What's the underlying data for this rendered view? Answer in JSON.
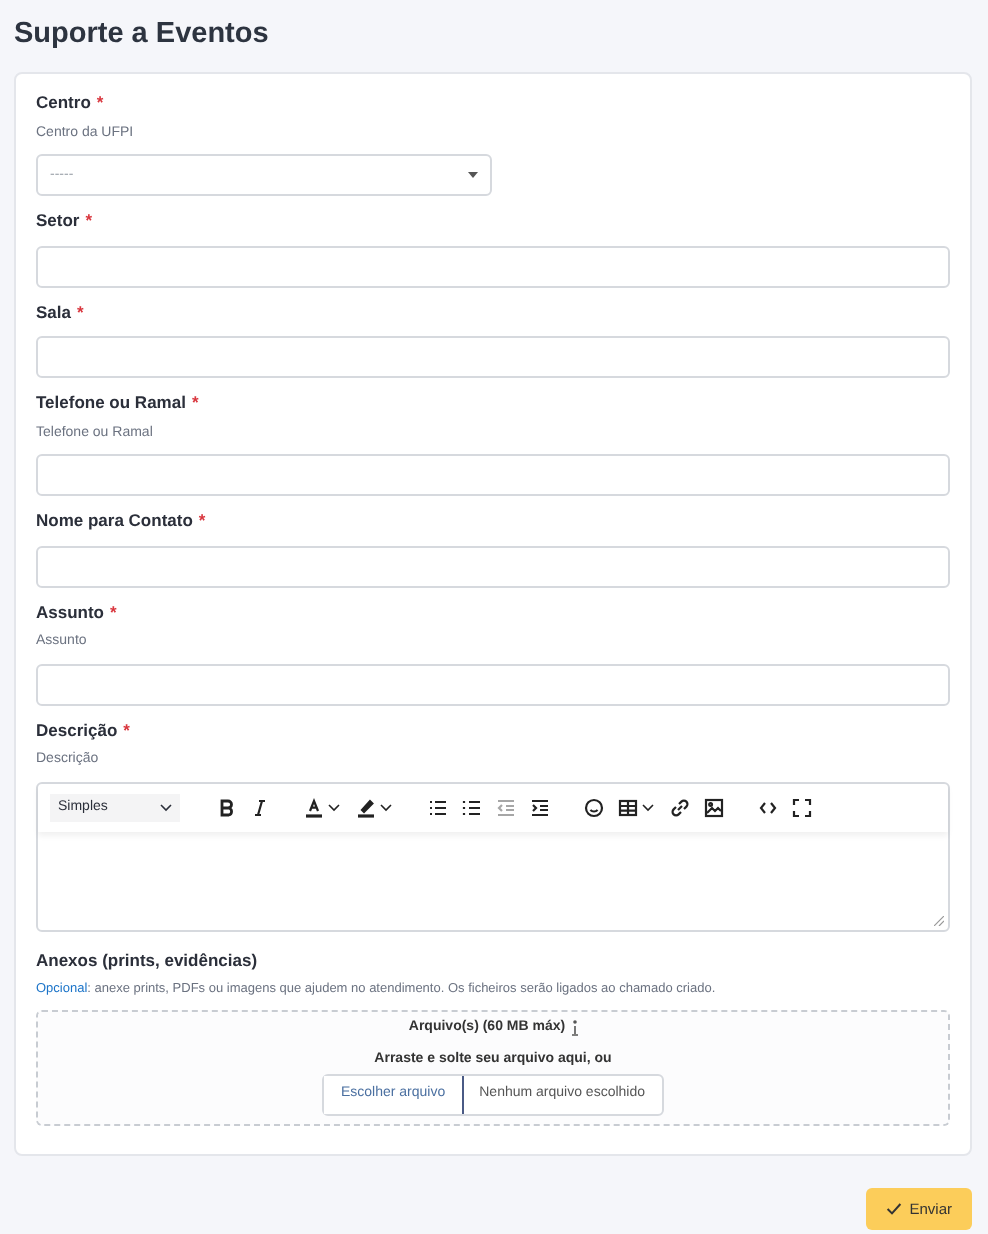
{
  "page_title": "Suporte a Eventos",
  "fields": [
    {
      "kind": "select",
      "label": "Centro",
      "required_mark": "*",
      "help": "Centro da UFPI",
      "value": "-----"
    },
    {
      "kind": "input",
      "label": "Setor",
      "required_mark": "*"
    },
    {
      "kind": "input",
      "label": "Sala",
      "required_mark": "*"
    },
    {
      "kind": "input",
      "label": "Telefone ou Ramal",
      "required_mark": "*",
      "help": "Telefone ou Ramal"
    },
    {
      "kind": "input",
      "label": "Nome para Contato",
      "required_mark": "*"
    },
    {
      "kind": "input",
      "label": "Assunto",
      "required_mark": "*",
      "help": "Assunto"
    },
    {
      "kind": "editor",
      "label": "Descrição",
      "required_mark": "*",
      "help": "Descrição",
      "style_select": "Simples",
      "toolbar": [
        {
          "kind": "bold",
          "disabled": false
        },
        {
          "kind": "italic",
          "disabled": false
        },
        {
          "kind": "text-color",
          "disabled": false
        },
        {
          "kind": "highlight",
          "disabled": false
        },
        {
          "kind": "bullet-list",
          "disabled": false
        },
        {
          "kind": "numbered-list",
          "disabled": false
        },
        {
          "kind": "outdent",
          "disabled": true
        },
        {
          "kind": "indent",
          "disabled": false
        },
        {
          "kind": "emoji",
          "disabled": false
        },
        {
          "kind": "table",
          "disabled": false
        },
        {
          "kind": "link",
          "disabled": false
        },
        {
          "kind": "image",
          "disabled": false
        },
        {
          "kind": "code",
          "disabled": false
        },
        {
          "kind": "fullscreen",
          "disabled": false
        }
      ]
    }
  ],
  "attachments": {
    "label": "Anexos (prints, evidências)",
    "help_link": "Opcional",
    "help": ": anexe prints, PDFs ou imagens que ajudem no atendimento. Os ficheiros serão ligados ao chamado criado.",
    "limit": "Arquivo(s) (60 MB máx)",
    "drop_text": "Arraste e solte seu arquivo aqui, ou",
    "choose_button": "Escolher arquivo",
    "file_status": "Nenhum arquivo escolhido"
  },
  "submit_button": "Enviar"
}
